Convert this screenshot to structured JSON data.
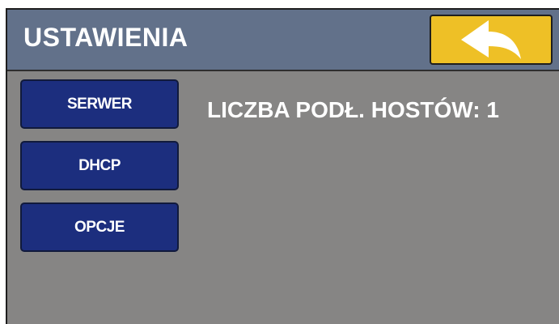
{
  "header": {
    "title": "USTAWIENIA",
    "back_icon": "back-arrow-icon"
  },
  "menu": {
    "items": [
      {
        "label": "SERWER"
      },
      {
        "label": "DHCP"
      },
      {
        "label": "OPCJE"
      }
    ]
  },
  "content": {
    "hosts_label": "LICZBA PODŁ. HOSTÓW:",
    "hosts_count": "1"
  },
  "colors": {
    "background": "#868584",
    "header": "#62718a",
    "button": "#1c2e7e",
    "back_button": "#eec026",
    "text": "#ffffff"
  }
}
